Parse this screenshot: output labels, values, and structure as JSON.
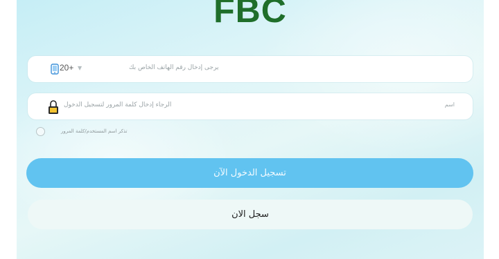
{
  "app": {
    "logo": "FBC"
  },
  "phone_field": {
    "country_code": "20+",
    "placeholder": "يرجى إدخال رقم الهاتف الخاص بك",
    "icon": "phone-icon"
  },
  "password_field": {
    "placeholder": "الرجاء إدخال كلمة المرور لتسجيل الدخول",
    "icon": "lock-icon",
    "toggle_hint": "اسم"
  },
  "remember": {
    "label": "تذكر اسم المستخدم/كلمة المرور",
    "checked": false
  },
  "buttons": {
    "login": "تسجيل الدخول الآن",
    "register": "سجل الان"
  },
  "colors": {
    "logo": "#1f6e2a",
    "login_button": "#61c3f0",
    "background": "#d8f2f6"
  }
}
